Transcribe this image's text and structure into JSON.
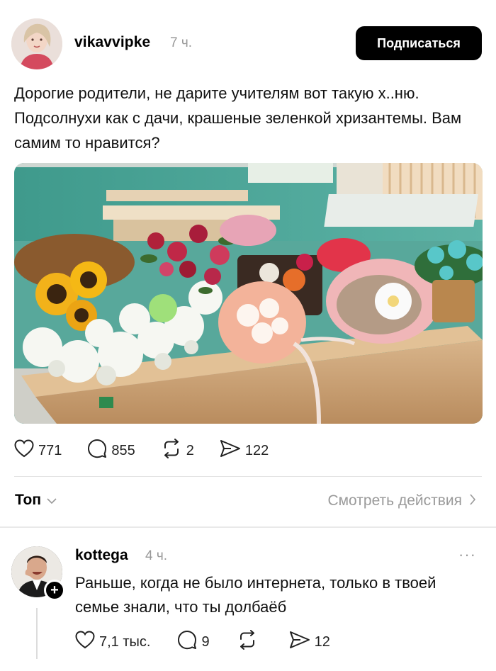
{
  "post": {
    "username": "vikavvipke",
    "time": "7 ч.",
    "follow_label": "Подписаться",
    "text": "Дорогие родители, не дарите учителям вот такую х..ню. Подсолнухи как с дачи, крашеные зеленкой хризантемы. Вам самим то нравится?",
    "stats": {
      "likes": "771",
      "comments": "855",
      "reposts": "2",
      "shares": "122"
    }
  },
  "replies_bar": {
    "sort_label": "Топ",
    "view_activity_label": "Смотреть действия"
  },
  "comment": {
    "username": "kottega",
    "time": "4 ч.",
    "more": "···",
    "plus": "+",
    "text": "Раньше, когда не было интернета, только в твоей семье знали, что ты долбаёб",
    "stats": {
      "likes": "7,1 тыс.",
      "comments": "9",
      "reposts": "",
      "shares": "12"
    }
  },
  "icons": {
    "like": "heart-icon",
    "comment": "speech-bubble-icon",
    "repost": "repost-icon",
    "share": "send-icon",
    "chevron_down": "chevron-down-icon",
    "chevron_right": "chevron-right-icon"
  }
}
